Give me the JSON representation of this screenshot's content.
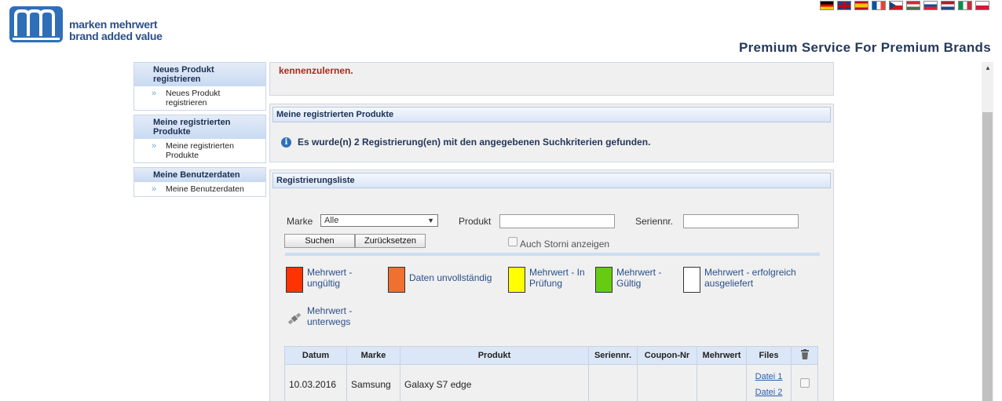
{
  "header": {
    "logo_line1": "marken mehrwert",
    "logo_line2": "brand added value",
    "slogan": "Premium Service For Premium Brands",
    "flags": [
      "de",
      "gb",
      "es",
      "fr",
      "cz",
      "hu",
      "sk",
      "nl",
      "it",
      "pl"
    ]
  },
  "sidebar": {
    "sections": [
      {
        "heading": "Neues Produkt registrieren",
        "item": "Neues Produkt registrieren"
      },
      {
        "heading": "Meine registrierten Produkte",
        "item": "Meine registrierten Produkte"
      },
      {
        "heading": "Meine Benutzerdaten",
        "item": "Meine Benutzerdaten"
      }
    ]
  },
  "intro": {
    "text": "kennenzulernen."
  },
  "results_panel": {
    "title": "Meine registrierten Produkte",
    "info": "Es wurde(n) 2 Registrierung(en) mit den angegebenen Suchkriterien gefunden."
  },
  "list_panel": {
    "title": "Registrierungsliste",
    "filter": {
      "marke_label": "Marke",
      "marke_value": "Alle",
      "produkt_label": "Produkt",
      "produkt_value": "",
      "seriennr_label": "Seriennr.",
      "seriennr_value": "",
      "search_button": "Suchen",
      "reset_button": "Zurücksetzen",
      "storni_label": "Auch Storni anzeigen"
    },
    "legend": [
      {
        "label": "Mehrwert - ungültig",
        "color": "#ff3300"
      },
      {
        "label": "Daten unvollständig",
        "color": "#f07030"
      },
      {
        "label": "Mehrwert - In Prüfung",
        "color": "#ffff00"
      },
      {
        "label": "Mehrwert - Gültig",
        "color": "#66cc11"
      },
      {
        "label": "Mehrwert - erfolgreich ausgeliefert",
        "color": "#ffffff"
      },
      {
        "label": "Mehrwert - unterwegs",
        "icon": "satellite-icon"
      }
    ],
    "table": {
      "headers": [
        "Datum",
        "Marke",
        "Produkt",
        "Seriennr.",
        "Coupon-Nr",
        "Mehrwert",
        "Files"
      ],
      "delete_icon": "trash-icon",
      "rows": [
        {
          "datum": "10.03.2016",
          "marke": "Samsung",
          "produkt": "Galaxy S7 edge",
          "seriennr": "",
          "coupon": "",
          "mehrwert": "",
          "file1": "Datei 1",
          "file2": "Datei 2"
        }
      ]
    }
  }
}
